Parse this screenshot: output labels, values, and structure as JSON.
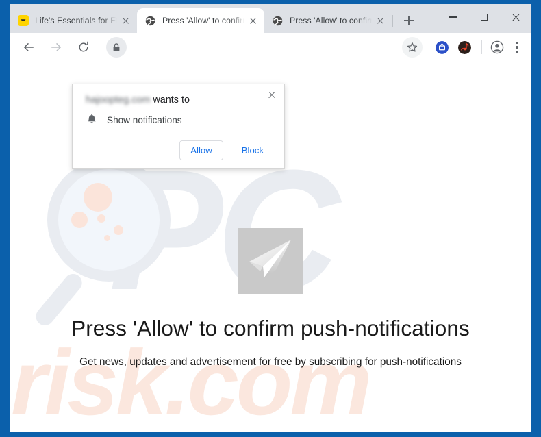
{
  "window": {
    "border_color": "#0b60ab",
    "controls": {
      "minimize": "minimize-window",
      "maximize": "maximize-window",
      "close": "close-window"
    }
  },
  "tabs": [
    {
      "title": "Life's Essentials for Effortl",
      "favicon": "smile-favicon",
      "active": false,
      "close_label": "close-tab"
    },
    {
      "title": "Press 'Allow' to confirm p",
      "favicon": "globe-favicon",
      "active": true,
      "close_label": "close-tab"
    },
    {
      "title": "Press 'Allow' to confirm p",
      "favicon": "globe-favicon",
      "active": false,
      "close_label": "close-tab"
    }
  ],
  "newtab_label": "+",
  "toolbar": {
    "back": "back-arrow",
    "forward": "forward-arrow",
    "reload": "reload-arrow",
    "site_info": "lock-icon",
    "bookmark": "star-icon",
    "extensions": [
      {
        "name": "tv-extension-icon",
        "color": "#2b50c8"
      },
      {
        "name": "music-extension-icon",
        "color": "#2b1f1a"
      }
    ],
    "profile": "profile-avatar-icon",
    "menu": "three-dot-menu"
  },
  "permission_dialog": {
    "domain": "hajoopteg.com",
    "title_suffix": " wants to",
    "permission_label": "Show notifications",
    "permission_icon": "bell-icon",
    "allow_label": "Allow",
    "block_label": "Block",
    "close_label": "close-dialog",
    "accent_color": "#1a73e8"
  },
  "page": {
    "hero_icon": "paper-plane-icon",
    "headline": "Press 'Allow' to confirm push-notifications",
    "subline": "Get news, updates and advertisement for free by subscribing for push-notifications",
    "watermark": {
      "logo": "magnifier-watermark",
      "text_top": "PC",
      "text_bottom": "risk.com",
      "color_grey": "#e9ecf1",
      "color_peach": "#fbe7de"
    }
  }
}
